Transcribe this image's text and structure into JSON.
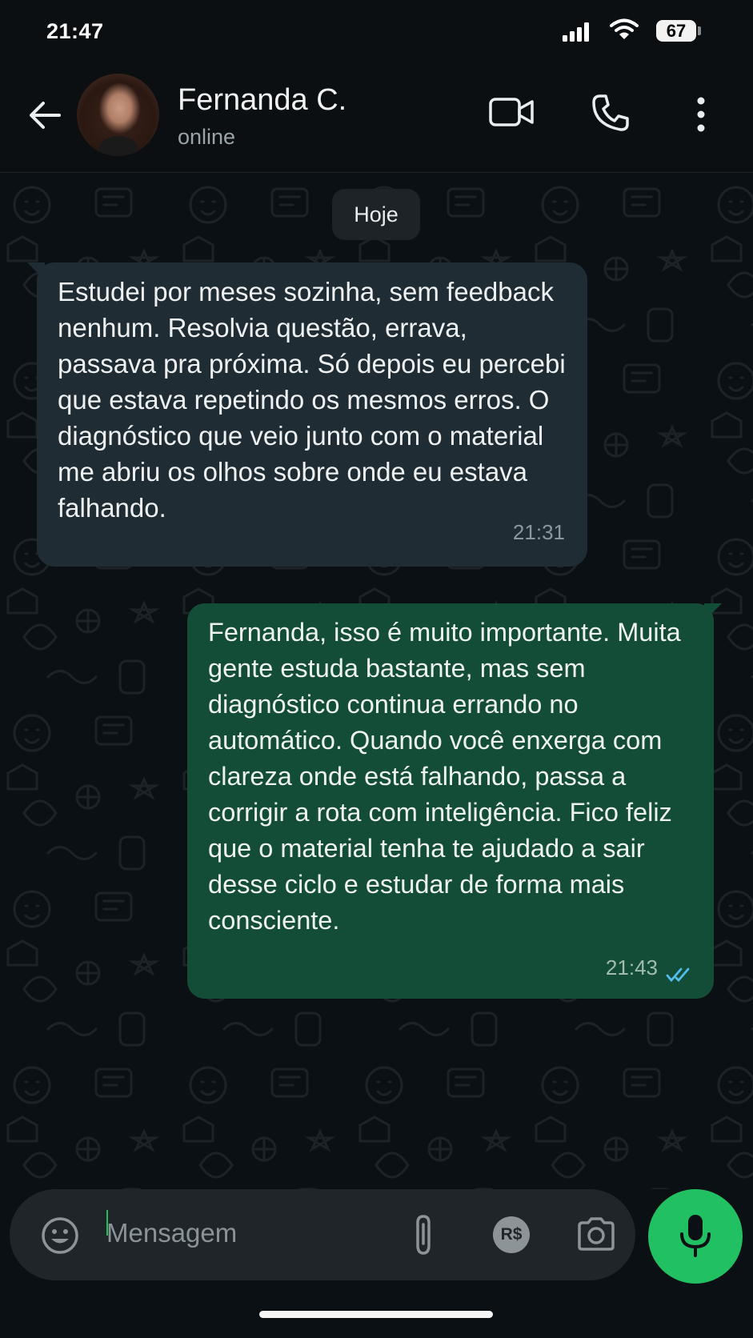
{
  "status_bar": {
    "time": "21:47",
    "battery": "67"
  },
  "header": {
    "contact_name": "Fernanda C.",
    "contact_status": "online",
    "icons": [
      "back-arrow-icon",
      "video-call-icon",
      "phone-call-icon",
      "more-options-icon"
    ]
  },
  "chat": {
    "date_chip": "Hoje",
    "messages": [
      {
        "direction": "incoming",
        "text": "Estudei por meses sozinha, sem feedback nenhum. Resolvia questão, errava, passava pra próxima. Só depois eu percebi que estava repetindo os mesmos erros. O diagnóstico que veio junto com o material me abriu os olhos sobre onde eu estava falhando.",
        "time": "21:31"
      },
      {
        "direction": "outgoing",
        "text": "Fernanda, isso é muito importante. Muita gente estuda bastante, mas sem diagnóstico continua errando no automático. Quando você enxerga com clareza onde está falhando, passa a corrigir a rota com inteligência. Fico feliz que o material tenha te ajudado a sair desse ciclo e estudar de forma mais consciente.",
        "time": "21:43",
        "status": "read"
      }
    ]
  },
  "composer": {
    "placeholder": "Mensagem",
    "payment_label": "R$",
    "icons": [
      "emoji-icon",
      "attach-icon",
      "payment-icon",
      "camera-icon",
      "mic-icon"
    ]
  },
  "colors": {
    "background": "#0b1014",
    "incoming_bubble": "#202c33",
    "outgoing_bubble": "#134d37",
    "accent": "#21c063",
    "read_ticks": "#53bdeb"
  }
}
